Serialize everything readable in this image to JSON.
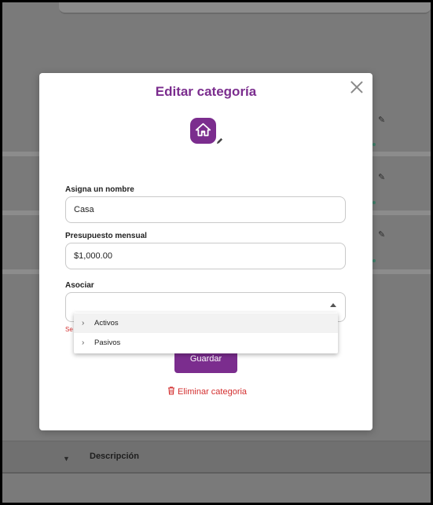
{
  "modal": {
    "title": "Editar categoría",
    "name_label": "Asigna un nombre",
    "name_value": "Casa",
    "budget_label": "Presupuesto mensual",
    "budget_value": "$1,000.00",
    "associate_label": "Asociar",
    "associate_value": "",
    "error_text": "Se",
    "save_label": "Guardar",
    "delete_label": "Eliminar categoria"
  },
  "dropdown": {
    "options": [
      {
        "label": "Activos"
      },
      {
        "label": "Pasivos"
      }
    ]
  },
  "background": {
    "table_header": "Descripción"
  },
  "colors": {
    "accent": "#7b2d8e",
    "danger": "#d32f2f"
  },
  "icons": {
    "category": "house-icon",
    "edit": "pencil-icon",
    "close": "close-icon",
    "delete": "trash-icon",
    "dropdown": "caret-up-icon",
    "option": "chevron-right-icon"
  }
}
